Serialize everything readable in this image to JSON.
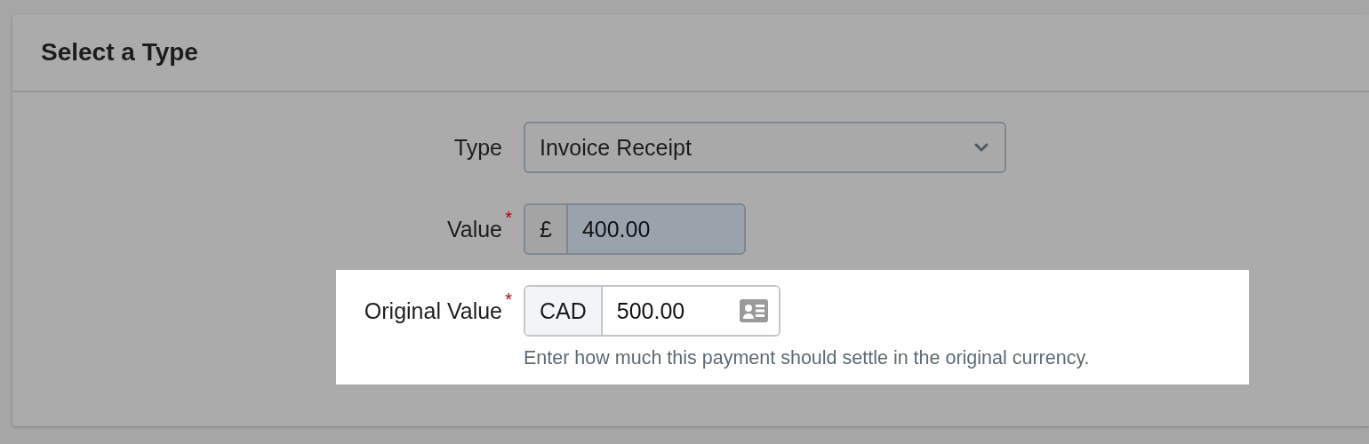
{
  "panel": {
    "title": "Select a Type"
  },
  "fields": [
    {
      "kind": "select",
      "label": "Type",
      "value": "Invoice Receipt"
    },
    {
      "kind": "money",
      "label": "Value",
      "required_mark": "*",
      "currency": "£",
      "value": "400.00",
      "autofilled": true
    },
    {
      "kind": "money",
      "label": "Original Value",
      "required_mark": "*",
      "currency": "CAD",
      "value": "500.00",
      "autofilled": false,
      "contact_icon": true,
      "highlighted": true,
      "help": "Enter how much this payment should settle in the original currency."
    }
  ]
}
